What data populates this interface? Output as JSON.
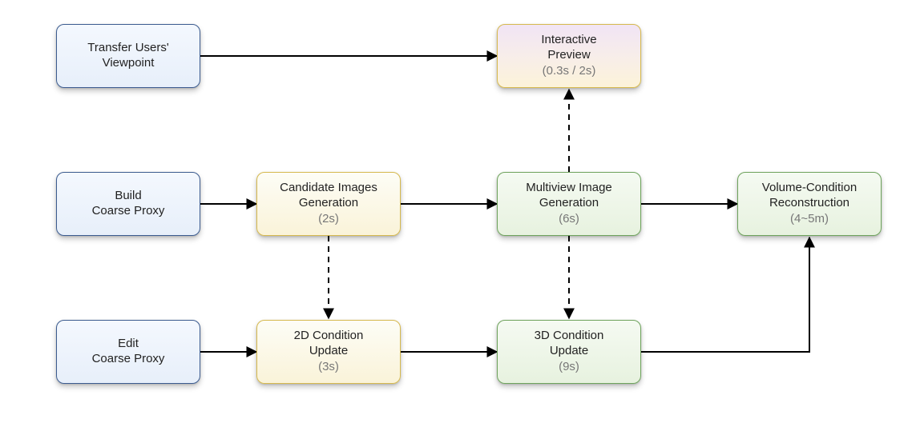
{
  "diagram": {
    "nodes": {
      "transfer_viewpoint": {
        "line1": "Transfer Users'",
        "line2": "Viewpoint"
      },
      "interactive_preview": {
        "line1": "Interactive",
        "line2": "Preview",
        "sub": "(0.3s / 2s)"
      },
      "build_coarse": {
        "line1": "Build",
        "line2": "Coarse Proxy"
      },
      "candidate_images": {
        "line1": "Candidate Images",
        "line2": "Generation",
        "sub": "(2s)"
      },
      "multiview_image": {
        "line1": "Multiview Image",
        "line2": "Generation",
        "sub": "(6s)"
      },
      "volume_recon": {
        "line1": "Volume-Condition",
        "line2": "Reconstruction",
        "sub": "(4~5m)"
      },
      "edit_coarse": {
        "line1": "Edit",
        "line2": "Coarse Proxy"
      },
      "cond2d_update": {
        "line1": "2D Condition",
        "line2": "Update",
        "sub": "(3s)"
      },
      "cond3d_update": {
        "line1": "3D Condition",
        "line2": "Update",
        "sub": "(9s)"
      }
    }
  }
}
